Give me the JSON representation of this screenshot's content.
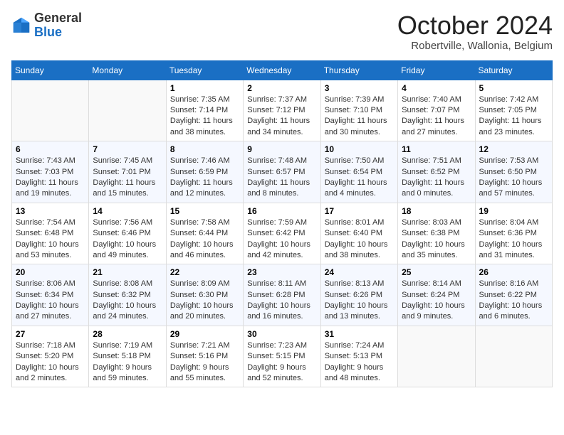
{
  "header": {
    "logo_general": "General",
    "logo_blue": "Blue",
    "month_title": "October 2024",
    "location": "Robertville, Wallonia, Belgium"
  },
  "weekdays": [
    "Sunday",
    "Monday",
    "Tuesday",
    "Wednesday",
    "Thursday",
    "Friday",
    "Saturday"
  ],
  "weeks": [
    [
      {
        "day": "",
        "info": ""
      },
      {
        "day": "",
        "info": ""
      },
      {
        "day": "1",
        "sunrise": "7:35 AM",
        "sunset": "7:14 PM",
        "daylight": "11 hours and 38 minutes."
      },
      {
        "day": "2",
        "sunrise": "7:37 AM",
        "sunset": "7:12 PM",
        "daylight": "11 hours and 34 minutes."
      },
      {
        "day": "3",
        "sunrise": "7:39 AM",
        "sunset": "7:10 PM",
        "daylight": "11 hours and 30 minutes."
      },
      {
        "day": "4",
        "sunrise": "7:40 AM",
        "sunset": "7:07 PM",
        "daylight": "11 hours and 27 minutes."
      },
      {
        "day": "5",
        "sunrise": "7:42 AM",
        "sunset": "7:05 PM",
        "daylight": "11 hours and 23 minutes."
      }
    ],
    [
      {
        "day": "6",
        "sunrise": "7:43 AM",
        "sunset": "7:03 PM",
        "daylight": "11 hours and 19 minutes."
      },
      {
        "day": "7",
        "sunrise": "7:45 AM",
        "sunset": "7:01 PM",
        "daylight": "11 hours and 15 minutes."
      },
      {
        "day": "8",
        "sunrise": "7:46 AM",
        "sunset": "6:59 PM",
        "daylight": "11 hours and 12 minutes."
      },
      {
        "day": "9",
        "sunrise": "7:48 AM",
        "sunset": "6:57 PM",
        "daylight": "11 hours and 8 minutes."
      },
      {
        "day": "10",
        "sunrise": "7:50 AM",
        "sunset": "6:54 PM",
        "daylight": "11 hours and 4 minutes."
      },
      {
        "day": "11",
        "sunrise": "7:51 AM",
        "sunset": "6:52 PM",
        "daylight": "11 hours and 0 minutes."
      },
      {
        "day": "12",
        "sunrise": "7:53 AM",
        "sunset": "6:50 PM",
        "daylight": "10 hours and 57 minutes."
      }
    ],
    [
      {
        "day": "13",
        "sunrise": "7:54 AM",
        "sunset": "6:48 PM",
        "daylight": "10 hours and 53 minutes."
      },
      {
        "day": "14",
        "sunrise": "7:56 AM",
        "sunset": "6:46 PM",
        "daylight": "10 hours and 49 minutes."
      },
      {
        "day": "15",
        "sunrise": "7:58 AM",
        "sunset": "6:44 PM",
        "daylight": "10 hours and 46 minutes."
      },
      {
        "day": "16",
        "sunrise": "7:59 AM",
        "sunset": "6:42 PM",
        "daylight": "10 hours and 42 minutes."
      },
      {
        "day": "17",
        "sunrise": "8:01 AM",
        "sunset": "6:40 PM",
        "daylight": "10 hours and 38 minutes."
      },
      {
        "day": "18",
        "sunrise": "8:03 AM",
        "sunset": "6:38 PM",
        "daylight": "10 hours and 35 minutes."
      },
      {
        "day": "19",
        "sunrise": "8:04 AM",
        "sunset": "6:36 PM",
        "daylight": "10 hours and 31 minutes."
      }
    ],
    [
      {
        "day": "20",
        "sunrise": "8:06 AM",
        "sunset": "6:34 PM",
        "daylight": "10 hours and 27 minutes."
      },
      {
        "day": "21",
        "sunrise": "8:08 AM",
        "sunset": "6:32 PM",
        "daylight": "10 hours and 24 minutes."
      },
      {
        "day": "22",
        "sunrise": "8:09 AM",
        "sunset": "6:30 PM",
        "daylight": "10 hours and 20 minutes."
      },
      {
        "day": "23",
        "sunrise": "8:11 AM",
        "sunset": "6:28 PM",
        "daylight": "10 hours and 16 minutes."
      },
      {
        "day": "24",
        "sunrise": "8:13 AM",
        "sunset": "6:26 PM",
        "daylight": "10 hours and 13 minutes."
      },
      {
        "day": "25",
        "sunrise": "8:14 AM",
        "sunset": "6:24 PM",
        "daylight": "10 hours and 9 minutes."
      },
      {
        "day": "26",
        "sunrise": "8:16 AM",
        "sunset": "6:22 PM",
        "daylight": "10 hours and 6 minutes."
      }
    ],
    [
      {
        "day": "27",
        "sunrise": "7:18 AM",
        "sunset": "5:20 PM",
        "daylight": "10 hours and 2 minutes."
      },
      {
        "day": "28",
        "sunrise": "7:19 AM",
        "sunset": "5:18 PM",
        "daylight": "9 hours and 59 minutes."
      },
      {
        "day": "29",
        "sunrise": "7:21 AM",
        "sunset": "5:16 PM",
        "daylight": "9 hours and 55 minutes."
      },
      {
        "day": "30",
        "sunrise": "7:23 AM",
        "sunset": "5:15 PM",
        "daylight": "9 hours and 52 minutes."
      },
      {
        "day": "31",
        "sunrise": "7:24 AM",
        "sunset": "5:13 PM",
        "daylight": "9 hours and 48 minutes."
      },
      {
        "day": "",
        "info": ""
      },
      {
        "day": "",
        "info": ""
      }
    ]
  ],
  "labels": {
    "sunrise": "Sunrise:",
    "sunset": "Sunset:",
    "daylight": "Daylight:"
  }
}
